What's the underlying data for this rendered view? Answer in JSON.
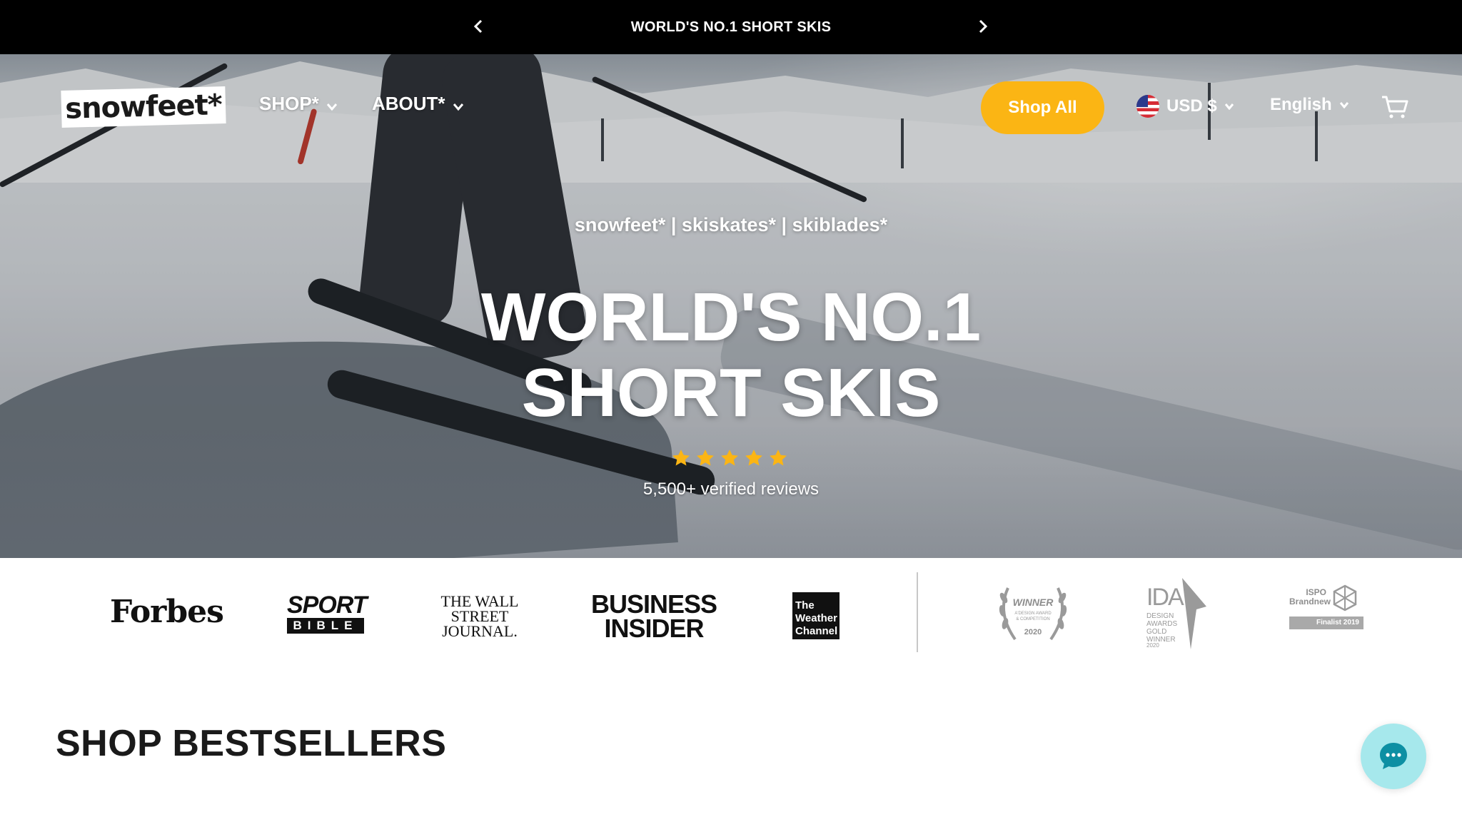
{
  "announcement": {
    "text": "WORLD'S NO.1 SHORT SKIS",
    "prev_icon": "chevron-left-icon",
    "next_icon": "chevron-right-icon"
  },
  "header": {
    "logo_text": "snowfeet*",
    "nav": [
      {
        "label": "SHOP*",
        "icon": "chevron-down-icon"
      },
      {
        "label": "ABOUT*",
        "icon": "chevron-down-icon"
      }
    ],
    "shop_all_label": "Shop All",
    "currency": "USD $",
    "language": "English",
    "cart_icon": "cart-icon",
    "accent_color": "#fbb514"
  },
  "hero": {
    "tagline": "snowfeet* | skiskates* | skiblades*",
    "headline_line1": "WORLD'S NO.1",
    "headline_line2": "SHORT SKIS",
    "rating_stars": 5,
    "reviews": "5,500+ verified reviews",
    "star_color": "#fbb514"
  },
  "press": {
    "logos": [
      "Forbes",
      "SPORT",
      "BIBLE",
      "THE WALL STREET JOURNAL.",
      "BUSINESS INSIDER",
      "The Weather Channel"
    ],
    "awards": [
      {
        "label": "WINNER",
        "sub": "A'DESIGN AWARD & COMPETITION",
        "year": "2020"
      },
      {
        "label": "IDA",
        "sub": "DESIGN AWARDS GOLD WINNER",
        "year": "2020"
      },
      {
        "label": "ISPO Brandnew",
        "sub": "Finalist 2019"
      }
    ]
  },
  "section": {
    "title": "SHOP BESTSELLERS"
  },
  "chat": {
    "icon": "chat-bubble-icon",
    "color": "#a6e8ec"
  }
}
